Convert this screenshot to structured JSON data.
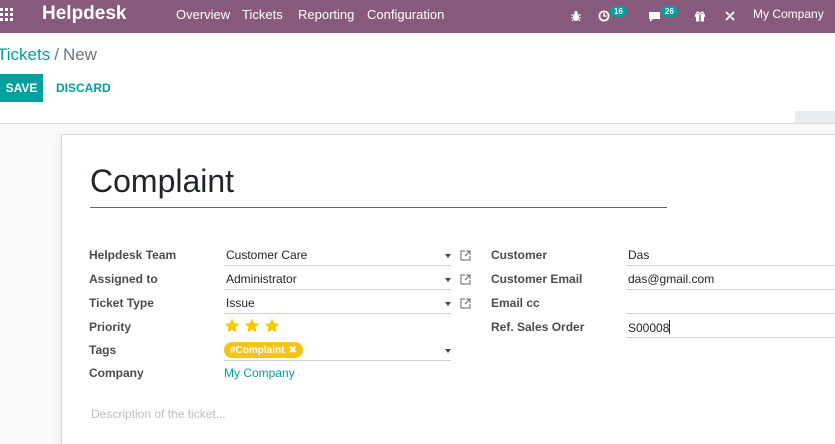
{
  "app": {
    "name": "Helpdesk",
    "menu": [
      "Overview",
      "Tickets",
      "Reporting",
      "Configuration"
    ],
    "company": "My Company",
    "counters": {
      "activities": "16",
      "messages": "26"
    },
    "icons": [
      "apps-grid-icon",
      "bug-icon",
      "activity-clock-icon",
      "chat-icon",
      "gift-icon",
      "tools-icon"
    ],
    "colors": {
      "navbar": "#875a7b",
      "primary": "#00a09d",
      "tag": "#f4c419"
    }
  },
  "breadcrumb": {
    "parent": "Tickets",
    "separator": "/",
    "current": "New"
  },
  "buttons": {
    "save": "SAVE",
    "discard": "DISCARD"
  },
  "form": {
    "title": "Complaint",
    "left": {
      "team": {
        "label": "Helpdesk Team",
        "value": "Customer Care"
      },
      "assigned": {
        "label": "Assigned to",
        "value": "Administrator"
      },
      "ticket_type": {
        "label": "Ticket Type",
        "value": "Issue"
      },
      "priority": {
        "label": "Priority",
        "stars": 3,
        "filled": 3
      },
      "tags": {
        "label": "Tags",
        "items": [
          "#Complaint"
        ]
      },
      "company": {
        "label": "Company",
        "value": "My Company"
      }
    },
    "right": {
      "customer": {
        "label": "Customer",
        "value": "Das"
      },
      "email": {
        "label": "Customer Email",
        "value": "das@gmail.com"
      },
      "email_cc": {
        "label": "Email cc",
        "value": ""
      },
      "sales_order": {
        "label": "Ref. Sales Order",
        "value": "S00008"
      }
    },
    "description_placeholder": "Description of the ticket..."
  }
}
